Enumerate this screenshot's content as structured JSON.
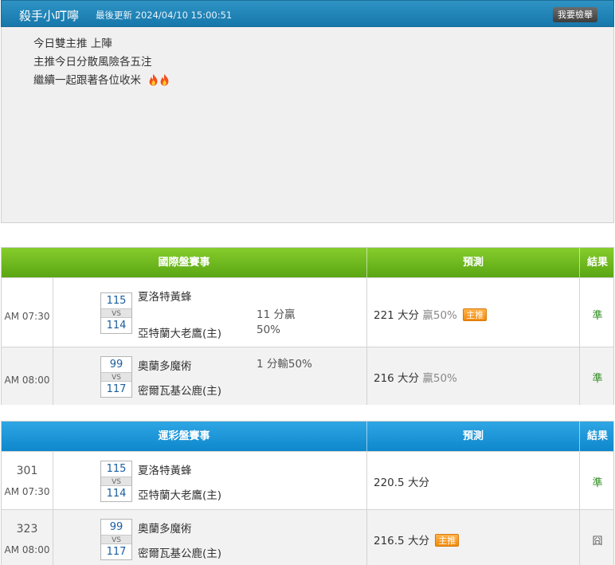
{
  "header": {
    "tipster_name": "殺手小叮嚀",
    "updated": "最後更新 2024/04/10 15:00:51",
    "report_button": "我要檢舉"
  },
  "message": {
    "lines": [
      "今日雙主推 上陣",
      "主推今日分散風險各五注",
      "繼續一起跟著各位收米"
    ],
    "emoji": [
      "fire-icon",
      "fire-icon"
    ]
  },
  "international": {
    "col_event": "國際盤賽事",
    "col_pred": "預測",
    "col_result": "結果",
    "rows": [
      {
        "time": "AM 07:30",
        "score_a": "115",
        "vs": "VS",
        "score_b": "114",
        "team_a": "夏洛特黃蜂",
        "team_b": "亞特蘭大老鷹(主)",
        "handicap_1": "11 分贏",
        "handicap_2": "50%",
        "pred_main": "221 大分",
        "pred_extra": "贏50%",
        "badge": "主推",
        "result": "準"
      },
      {
        "time": "AM 08:00",
        "score_a": "99",
        "vs": "VS",
        "score_b": "117",
        "team_a": "奧蘭多魔術",
        "team_b": "密爾瓦基公鹿(主)",
        "handicap_1": "1 分輸50%",
        "pred_main": "216 大分",
        "pred_extra": "贏50%",
        "result": "準"
      }
    ]
  },
  "sports_lottery": {
    "col_event": "運彩盤賽事",
    "col_pred": "預測",
    "col_result": "結果",
    "rows": [
      {
        "code": "301",
        "time": "AM 07:30",
        "score_a": "115",
        "vs": "VS",
        "score_b": "114",
        "team_a": "夏洛特黃蜂",
        "team_b": "亞特蘭大老鷹(主)",
        "pred_main": "220.5 大分",
        "result": "準"
      },
      {
        "code": "323",
        "time": "AM 08:00",
        "score_a": "99",
        "vs": "VS",
        "score_b": "117",
        "team_a": "奧蘭多魔術",
        "team_b": "密爾瓦基公鹿(主)",
        "pred_main": "216.5 大分",
        "badge": "主推",
        "result": "囧"
      }
    ]
  },
  "colors": {
    "header_blue": "#1677ab",
    "green_header": "#5aa513",
    "blue_header": "#0e87cc",
    "badge_orange": "#f08a0a",
    "result_green": "#2c8a1e"
  }
}
